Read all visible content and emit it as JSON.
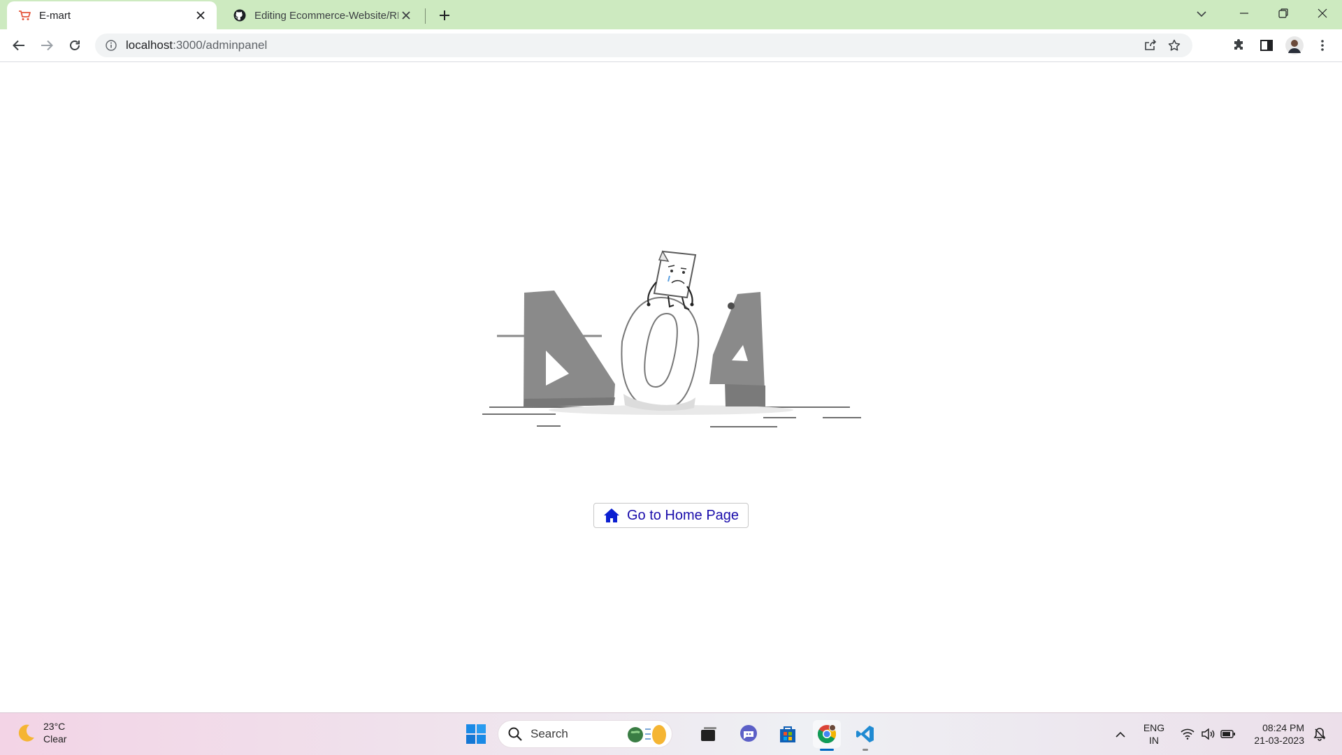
{
  "browser": {
    "tabs": [
      {
        "title": "E-mart",
        "active": true
      },
      {
        "title": "Editing Ecommerce-Website/REA",
        "active": false
      }
    ],
    "address": {
      "host": "localhost",
      "path": ":3000/adminpanel"
    }
  },
  "page": {
    "illustration_text": "404",
    "home_button_label": "Go to Home Page"
  },
  "taskbar": {
    "weather": {
      "temp": "23°C",
      "condition": "Clear"
    },
    "search_label": "Search",
    "language": {
      "line1": "ENG",
      "line2": "IN"
    },
    "clock": {
      "time": "08:24 PM",
      "date": "21-03-2023"
    }
  },
  "colors": {
    "tabstrip": "#cdeac0",
    "link_blue": "#1a0dab",
    "home_icon": "#0b1fd1",
    "digit_gray": "#8a8a8a"
  }
}
